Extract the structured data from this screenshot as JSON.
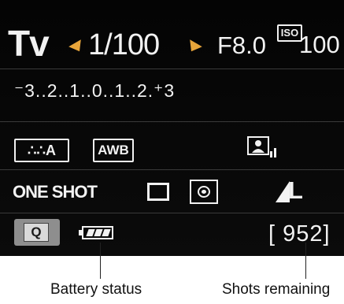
{
  "lcd": {
    "mode": "Tv",
    "shutter_speed": "1/100",
    "aperture": "F8.0",
    "iso_label": "ISO",
    "iso_value": "100",
    "exposure_scale": "⁻3..2..1..0..1..2.⁺3",
    "picture_style": "∴∴A",
    "white_balance": "AWB",
    "af_mode": "ONE SHOT",
    "quality": "L",
    "q_button": "Q",
    "shots_remaining": "[ 952]",
    "battery_level": 1.0,
    "accent_color": "#e8a53a"
  },
  "callouts": {
    "battery": "Battery status",
    "shots": "Shots remaining"
  }
}
